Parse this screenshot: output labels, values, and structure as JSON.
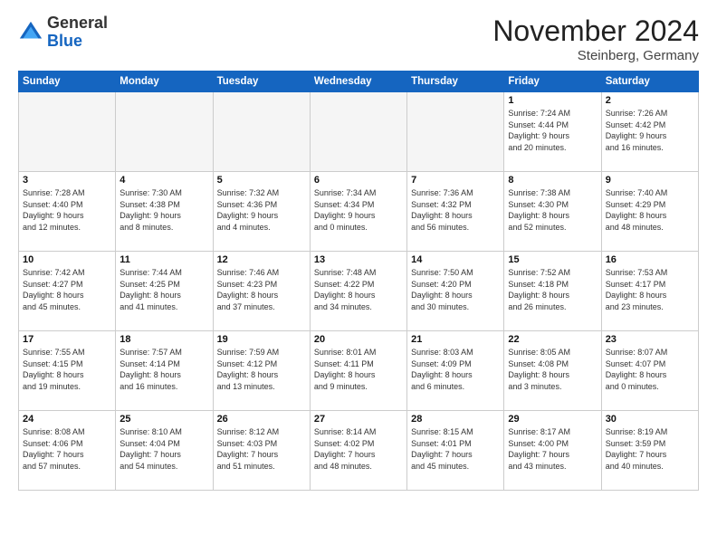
{
  "header": {
    "logo_general": "General",
    "logo_blue": "Blue",
    "month_title": "November 2024",
    "location": "Steinberg, Germany"
  },
  "weekdays": [
    "Sunday",
    "Monday",
    "Tuesday",
    "Wednesday",
    "Thursday",
    "Friday",
    "Saturday"
  ],
  "weeks": [
    [
      {
        "day": "",
        "info": ""
      },
      {
        "day": "",
        "info": ""
      },
      {
        "day": "",
        "info": ""
      },
      {
        "day": "",
        "info": ""
      },
      {
        "day": "",
        "info": ""
      },
      {
        "day": "1",
        "info": "Sunrise: 7:24 AM\nSunset: 4:44 PM\nDaylight: 9 hours\nand 20 minutes."
      },
      {
        "day": "2",
        "info": "Sunrise: 7:26 AM\nSunset: 4:42 PM\nDaylight: 9 hours\nand 16 minutes."
      }
    ],
    [
      {
        "day": "3",
        "info": "Sunrise: 7:28 AM\nSunset: 4:40 PM\nDaylight: 9 hours\nand 12 minutes."
      },
      {
        "day": "4",
        "info": "Sunrise: 7:30 AM\nSunset: 4:38 PM\nDaylight: 9 hours\nand 8 minutes."
      },
      {
        "day": "5",
        "info": "Sunrise: 7:32 AM\nSunset: 4:36 PM\nDaylight: 9 hours\nand 4 minutes."
      },
      {
        "day": "6",
        "info": "Sunrise: 7:34 AM\nSunset: 4:34 PM\nDaylight: 9 hours\nand 0 minutes."
      },
      {
        "day": "7",
        "info": "Sunrise: 7:36 AM\nSunset: 4:32 PM\nDaylight: 8 hours\nand 56 minutes."
      },
      {
        "day": "8",
        "info": "Sunrise: 7:38 AM\nSunset: 4:30 PM\nDaylight: 8 hours\nand 52 minutes."
      },
      {
        "day": "9",
        "info": "Sunrise: 7:40 AM\nSunset: 4:29 PM\nDaylight: 8 hours\nand 48 minutes."
      }
    ],
    [
      {
        "day": "10",
        "info": "Sunrise: 7:42 AM\nSunset: 4:27 PM\nDaylight: 8 hours\nand 45 minutes."
      },
      {
        "day": "11",
        "info": "Sunrise: 7:44 AM\nSunset: 4:25 PM\nDaylight: 8 hours\nand 41 minutes."
      },
      {
        "day": "12",
        "info": "Sunrise: 7:46 AM\nSunset: 4:23 PM\nDaylight: 8 hours\nand 37 minutes."
      },
      {
        "day": "13",
        "info": "Sunrise: 7:48 AM\nSunset: 4:22 PM\nDaylight: 8 hours\nand 34 minutes."
      },
      {
        "day": "14",
        "info": "Sunrise: 7:50 AM\nSunset: 4:20 PM\nDaylight: 8 hours\nand 30 minutes."
      },
      {
        "day": "15",
        "info": "Sunrise: 7:52 AM\nSunset: 4:18 PM\nDaylight: 8 hours\nand 26 minutes."
      },
      {
        "day": "16",
        "info": "Sunrise: 7:53 AM\nSunset: 4:17 PM\nDaylight: 8 hours\nand 23 minutes."
      }
    ],
    [
      {
        "day": "17",
        "info": "Sunrise: 7:55 AM\nSunset: 4:15 PM\nDaylight: 8 hours\nand 19 minutes."
      },
      {
        "day": "18",
        "info": "Sunrise: 7:57 AM\nSunset: 4:14 PM\nDaylight: 8 hours\nand 16 minutes."
      },
      {
        "day": "19",
        "info": "Sunrise: 7:59 AM\nSunset: 4:12 PM\nDaylight: 8 hours\nand 13 minutes."
      },
      {
        "day": "20",
        "info": "Sunrise: 8:01 AM\nSunset: 4:11 PM\nDaylight: 8 hours\nand 9 minutes."
      },
      {
        "day": "21",
        "info": "Sunrise: 8:03 AM\nSunset: 4:09 PM\nDaylight: 8 hours\nand 6 minutes."
      },
      {
        "day": "22",
        "info": "Sunrise: 8:05 AM\nSunset: 4:08 PM\nDaylight: 8 hours\nand 3 minutes."
      },
      {
        "day": "23",
        "info": "Sunrise: 8:07 AM\nSunset: 4:07 PM\nDaylight: 8 hours\nand 0 minutes."
      }
    ],
    [
      {
        "day": "24",
        "info": "Sunrise: 8:08 AM\nSunset: 4:06 PM\nDaylight: 7 hours\nand 57 minutes."
      },
      {
        "day": "25",
        "info": "Sunrise: 8:10 AM\nSunset: 4:04 PM\nDaylight: 7 hours\nand 54 minutes."
      },
      {
        "day": "26",
        "info": "Sunrise: 8:12 AM\nSunset: 4:03 PM\nDaylight: 7 hours\nand 51 minutes."
      },
      {
        "day": "27",
        "info": "Sunrise: 8:14 AM\nSunset: 4:02 PM\nDaylight: 7 hours\nand 48 minutes."
      },
      {
        "day": "28",
        "info": "Sunrise: 8:15 AM\nSunset: 4:01 PM\nDaylight: 7 hours\nand 45 minutes."
      },
      {
        "day": "29",
        "info": "Sunrise: 8:17 AM\nSunset: 4:00 PM\nDaylight: 7 hours\nand 43 minutes."
      },
      {
        "day": "30",
        "info": "Sunrise: 8:19 AM\nSunset: 3:59 PM\nDaylight: 7 hours\nand 40 minutes."
      }
    ]
  ]
}
